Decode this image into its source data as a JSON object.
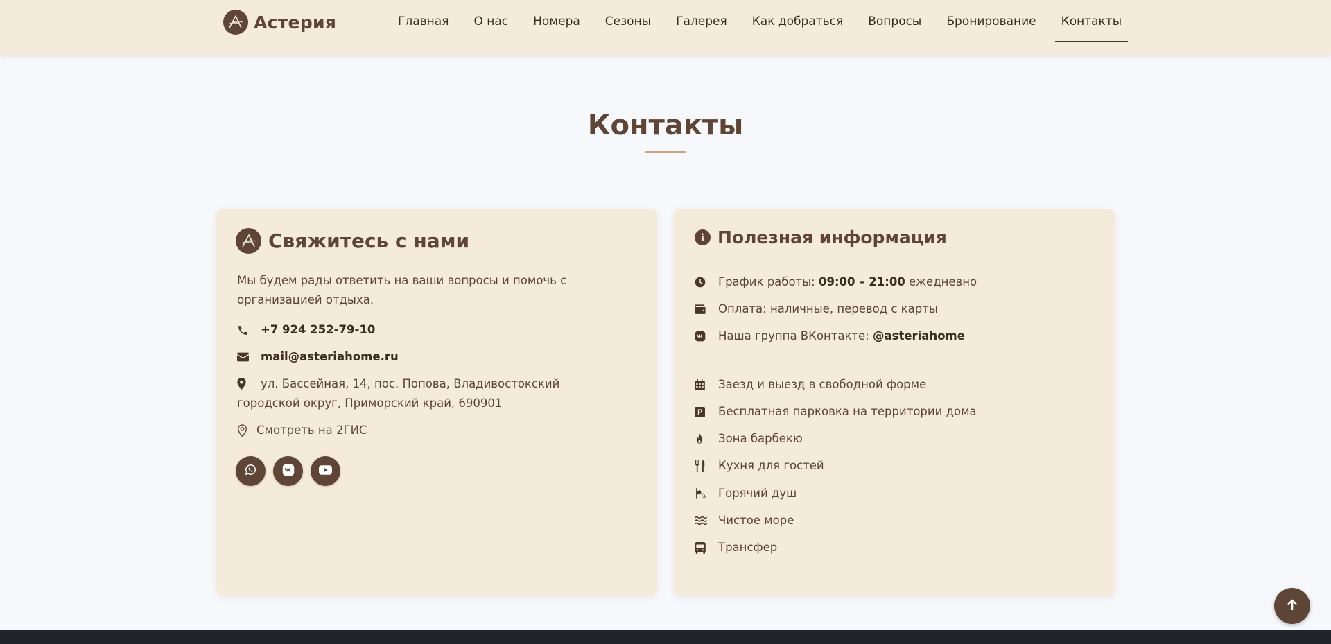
{
  "brand": {
    "name": "Астерия"
  },
  "nav": {
    "items": [
      "Главная",
      "О нас",
      "Номера",
      "Сезоны",
      "Галерея",
      "Как добраться",
      "Вопросы",
      "Бронирование",
      "Контакты"
    ],
    "active": "Контакты"
  },
  "page": {
    "title": "Контакты"
  },
  "contact": {
    "heading": "Свяжитесь с нами",
    "intro": "Мы будем рады ответить на ваши вопросы и помочь с организацией отдыха.",
    "phone": "+7 924 252-79-10",
    "email": "mail@asteriahome.ru",
    "address": "ул. Бассейная, 14, пос. Попова, Владивостокский городской округ, Приморский край, 690901",
    "map_link": "Смотреть на 2ГИС",
    "social": [
      "whatsapp-icon",
      "vk-icon",
      "youtube-icon"
    ]
  },
  "info": {
    "heading": "Полезная информация",
    "hours_label": "График работы: ",
    "hours_value": "09:00 – 21:00",
    "hours_suffix": " ежедневно",
    "payment": "Оплата: наличные, перевод с карты",
    "vk_label": "Наша группа ВКонтакте: ",
    "vk_handle": "@asteriahome",
    "features": [
      "Заезд и выезд в свободной форме",
      "Бесплатная парковка на территории дома",
      "Зона барбекю",
      "Кухня для гостей",
      "Горячий душ",
      "Чистое море",
      "Трансфер"
    ]
  },
  "colors": {
    "header_bg": "#f5ebdb",
    "card_bg": "#f5ebdb",
    "accent": "#5e4535",
    "title_rule": "#c9a57e",
    "page_bg": "#f7f8fb",
    "footer": "#212529"
  }
}
